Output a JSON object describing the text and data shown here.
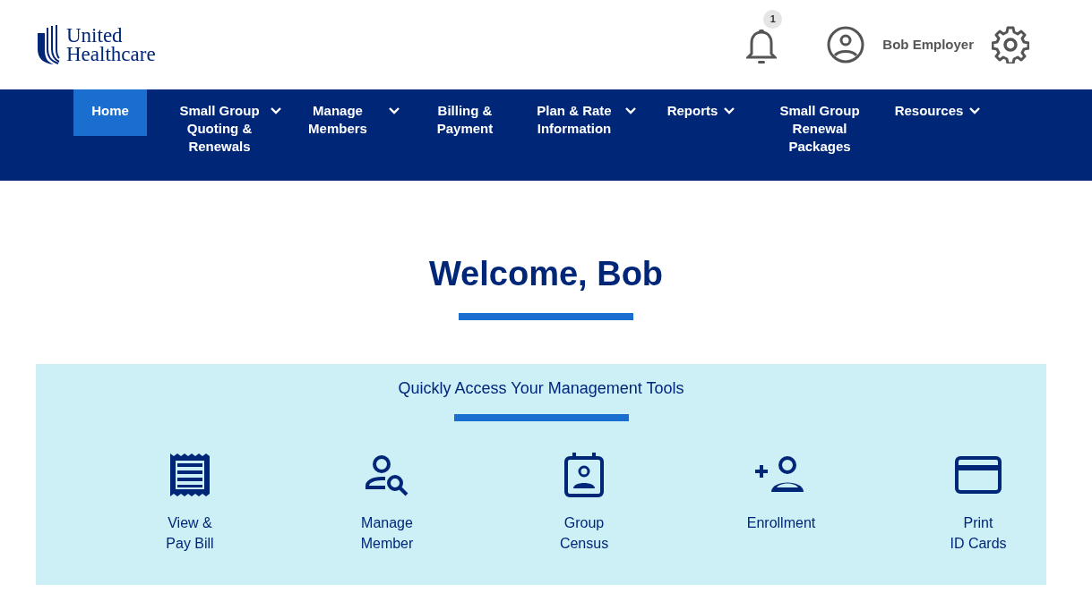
{
  "header": {
    "logo_text": [
      "United",
      "Healthcare"
    ],
    "notification_count": "1",
    "user_name": "Bob Employer"
  },
  "nav": [
    {
      "label": "Home",
      "selected": true,
      "dropdown": false
    },
    {
      "label": "Small Group Quoting & Renewals",
      "selected": false,
      "dropdown": true
    },
    {
      "label": "Manage Members",
      "selected": false,
      "dropdown": true
    },
    {
      "label": "Billing & Payment",
      "selected": false,
      "dropdown": false
    },
    {
      "label": "Plan & Rate Information",
      "selected": false,
      "dropdown": true
    },
    {
      "label": "Reports",
      "selected": false,
      "dropdown": true
    },
    {
      "label": "Small Group Renewal Packages",
      "selected": false,
      "dropdown": false
    },
    {
      "label": "Resources",
      "selected": false,
      "dropdown": true
    }
  ],
  "welcome": "Welcome, Bob",
  "tools": {
    "title": "Quickly Access Your Management Tools",
    "items": [
      {
        "kind": "bill",
        "lines": [
          "View &",
          "Pay Bill"
        ]
      },
      {
        "kind": "member",
        "lines": [
          "Manage",
          "Member"
        ]
      },
      {
        "kind": "census",
        "lines": [
          "Group",
          "Census"
        ]
      },
      {
        "kind": "enroll",
        "lines": [
          "Enrollment"
        ]
      },
      {
        "kind": "card",
        "lines": [
          "Print",
          "ID Cards"
        ]
      }
    ]
  }
}
